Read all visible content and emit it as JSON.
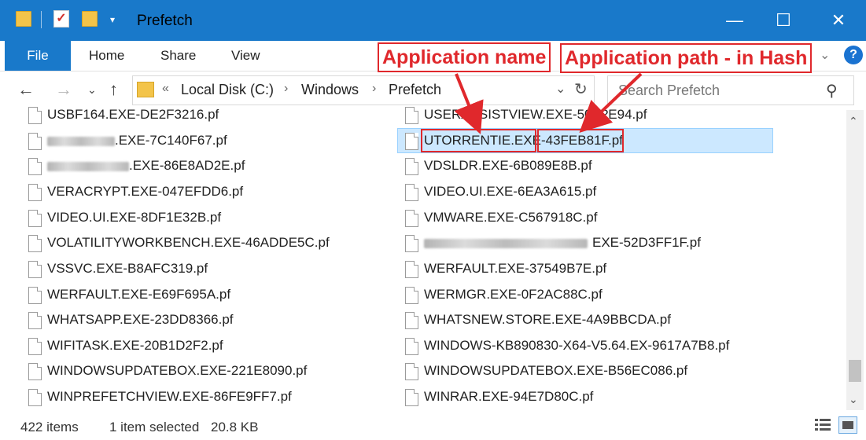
{
  "window": {
    "title": "Prefetch",
    "controls": {
      "minimize": "—",
      "maximize": "☐",
      "close": "✕"
    }
  },
  "ribbon": {
    "tabs": [
      "File",
      "Home",
      "Share",
      "View"
    ]
  },
  "address": {
    "prefix": "«",
    "crumbs": [
      "Local Disk (C:)",
      "Windows",
      "Prefetch"
    ],
    "separator": "›"
  },
  "search": {
    "placeholder": "Search Prefetch"
  },
  "files": {
    "left": [
      {
        "name": "USBF164.EXE-DE2F3216.pf"
      },
      {
        "name": ".EXE-7C140F67.pf",
        "redacted": true
      },
      {
        "name": ".EXE-86E8AD2E.pf",
        "redacted": true
      },
      {
        "name": "VERACRYPT.EXE-047EFDD6.pf"
      },
      {
        "name": "VIDEO.UI.EXE-8DF1E32B.pf"
      },
      {
        "name": "VOLATILITYWORKBENCH.EXE-46ADDE5C.pf"
      },
      {
        "name": "VSSVC.EXE-B8AFC319.pf"
      },
      {
        "name": "WERFAULT.EXE-E69F695A.pf"
      },
      {
        "name": "WHATSAPP.EXE-23DD8366.pf"
      },
      {
        "name": "WIFITASK.EXE-20B1D2F2.pf"
      },
      {
        "name": "WINDOWSUPDATEBOX.EXE-221E8090.pf"
      },
      {
        "name": "WINPREFETCHVIEW.EXE-86FE9FF7.pf"
      }
    ],
    "right": [
      {
        "name": "USERASSISTVIEW.EXE-50A?E94.pf"
      },
      {
        "name_app": "UTORRENTIE.EXE",
        "name_dash": "-",
        "name_hash": "43FEB81F.pf",
        "selected": true
      },
      {
        "name": "VDSLDR.EXE-6B089E8B.pf"
      },
      {
        "name": "VIDEO.UI.EXE-6EA3A615.pf"
      },
      {
        "name": "VMWARE.EXE-C567918C.pf"
      },
      {
        "name": "EXE-52D3FF1F.pf",
        "redacted": true
      },
      {
        "name": "WERFAULT.EXE-37549B7E.pf"
      },
      {
        "name": "WERMGR.EXE-0F2AC88C.pf"
      },
      {
        "name": "WHATSNEW.STORE.EXE-4A9BBCDA.pf"
      },
      {
        "name": "WINDOWS-KB890830-X64-V5.64.EX-9617A7B8.pf"
      },
      {
        "name": "WINDOWSUPDATEBOX.EXE-B56EC086.pf"
      },
      {
        "name": "WINRAR.EXE-94E7D80C.pf"
      }
    ]
  },
  "status": {
    "count": "422 items",
    "selection": "1 item selected",
    "size": "20.8 KB"
  },
  "annotations": {
    "app_name": "Application name",
    "app_path": "Application path - in Hash",
    "color": "#e0282c"
  },
  "colors": {
    "titlebar": "#1979ca",
    "selection": "#cce8ff",
    "folder": "#f3c44a"
  }
}
